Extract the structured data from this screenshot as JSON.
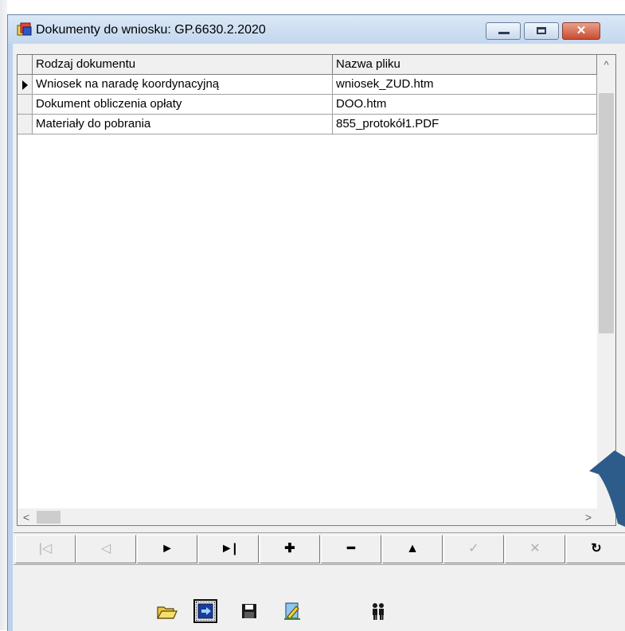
{
  "window": {
    "title": "Dokumenty do wniosku: GP.6630.2.2020"
  },
  "grid": {
    "columns": [
      "Rodzaj dokumentu",
      "Nazwa pliku"
    ],
    "rows": [
      {
        "type": "Wniosek na naradę koordynacyjną",
        "file": "wniosek_ZUD.htm",
        "current": true
      },
      {
        "type": "Dokument obliczenia opłaty",
        "file": "DOO.htm",
        "current": false
      },
      {
        "type": "Materiały do pobrania",
        "file": "855_protokół1.PDF",
        "current": false
      }
    ]
  },
  "scrollbars": {
    "up_arrow": "^",
    "left_arrow": "<",
    "right_arrow": ">"
  },
  "navigator": [
    {
      "name": "first-record-button",
      "glyph": "|◁",
      "enabled": false
    },
    {
      "name": "prior-record-button",
      "glyph": "◁",
      "enabled": false
    },
    {
      "name": "next-record-button",
      "glyph": "►",
      "enabled": true
    },
    {
      "name": "last-record-button",
      "glyph": "►|",
      "enabled": true
    },
    {
      "name": "insert-record-button",
      "glyph": "✚",
      "enabled": true
    },
    {
      "name": "delete-record-button",
      "glyph": "━",
      "enabled": true
    },
    {
      "name": "edit-record-button",
      "glyph": "▲",
      "enabled": true
    },
    {
      "name": "post-edit-button",
      "glyph": "✓",
      "enabled": false
    },
    {
      "name": "cancel-edit-button",
      "glyph": "✕",
      "enabled": false
    },
    {
      "name": "refresh-button",
      "glyph": "↻",
      "enabled": true
    }
  ],
  "toolbar": {
    "icons": [
      "open-folder-icon",
      "export-icon",
      "save-icon",
      "edit-document-icon",
      "users-icon"
    ],
    "selected": "export-icon"
  },
  "colors": {
    "window_frame": "#bcd3ec",
    "close_button": "#c94c31",
    "overlay_arrow": "#2e5c8a"
  }
}
